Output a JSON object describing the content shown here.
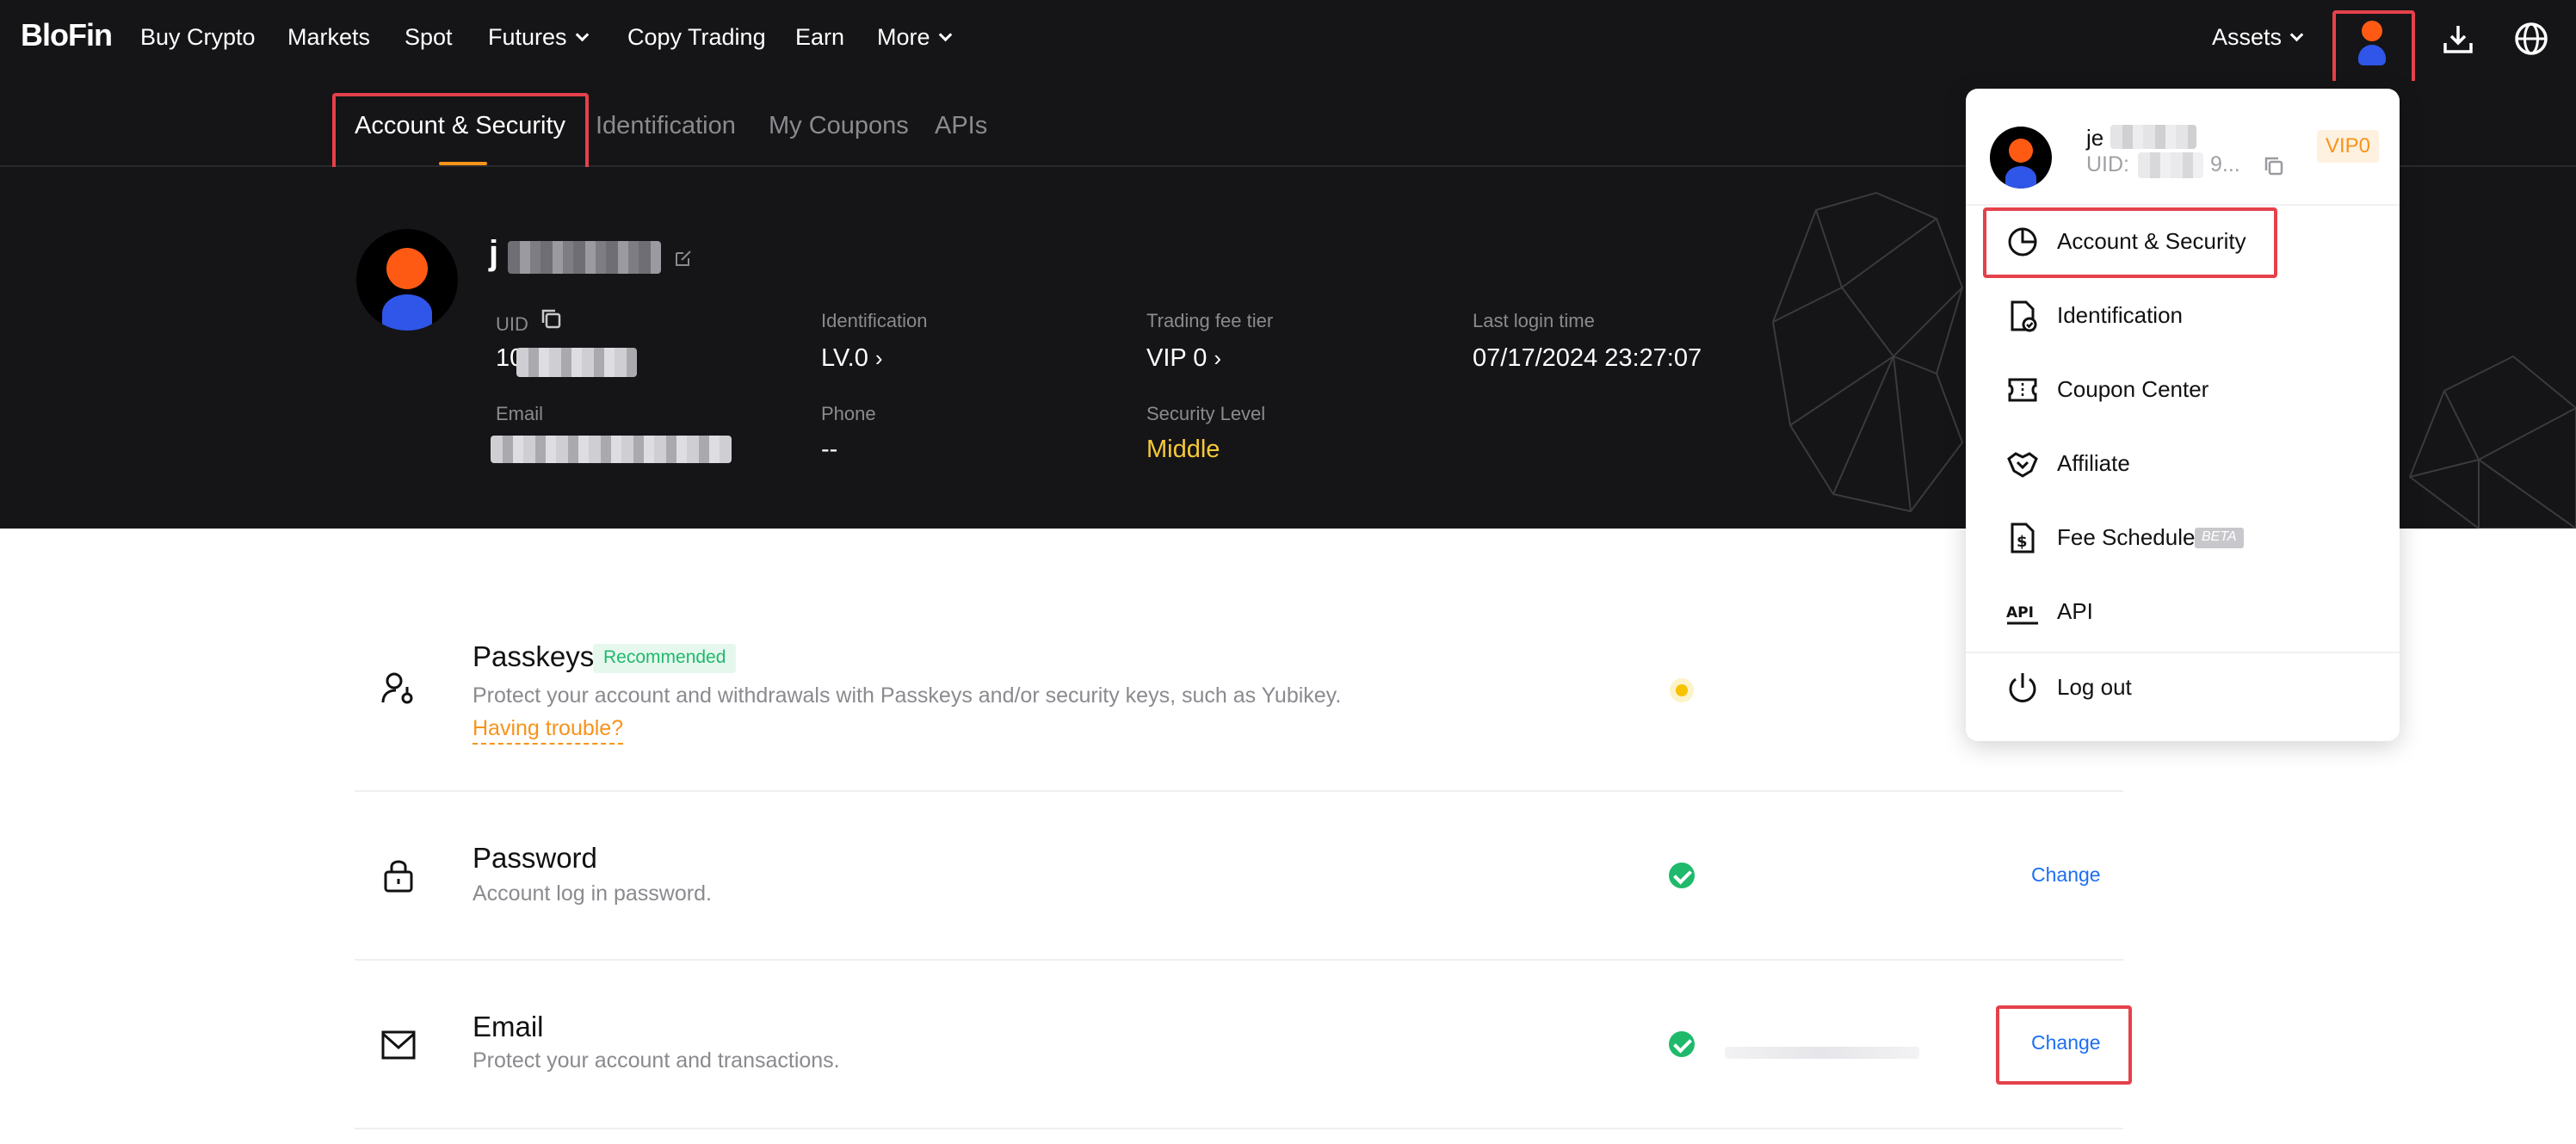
{
  "nav": {
    "logo": "BloFin",
    "items": [
      {
        "label": "Buy Crypto"
      },
      {
        "label": "Markets"
      },
      {
        "label": "Spot"
      },
      {
        "label": "Futures"
      },
      {
        "label": "Copy Trading"
      },
      {
        "label": "Earn"
      },
      {
        "label": "More"
      }
    ],
    "assets_label": "Assets",
    "icons": [
      "user-avatar-icon",
      "download-icon",
      "globe-icon"
    ]
  },
  "tabs": [
    {
      "label": "Account & Security",
      "active": true
    },
    {
      "label": "Identification"
    },
    {
      "label": "My Coupons"
    },
    {
      "label": "APIs"
    }
  ],
  "profile": {
    "name_visible": "j",
    "uid_label": "UID",
    "uid_value": "10",
    "email_label": "Email",
    "identification_label": "Identification",
    "identification_value": "LV.0",
    "phone_label": "Phone",
    "phone_value": "--",
    "fee_tier_label": "Trading fee tier",
    "fee_tier_value": "VIP 0",
    "security_level_label": "Security Level",
    "security_level_value": "Middle",
    "last_login_label": "Last login time",
    "last_login_value": "07/17/2024 23:27:07"
  },
  "security": {
    "passkeys": {
      "title": "Passkeys",
      "badge": "Recommended",
      "desc": "Protect your account and withdrawals with Passkeys and/or security keys, such as Yubikey.",
      "link": "Having trouble?"
    },
    "password": {
      "title": "Password",
      "desc": "Account log in password.",
      "action": "Change"
    },
    "email": {
      "title": "Email",
      "desc": "Protect your account and transactions.",
      "action": "Change"
    }
  },
  "dropdown": {
    "user_name_visible": "je",
    "uid_label": "UID:",
    "uid_suffix": "9...",
    "vip_badge": "VIP0",
    "items": [
      {
        "label": "Account & Security",
        "icon": "pie-chart-icon"
      },
      {
        "label": "Identification",
        "icon": "id-document-icon"
      },
      {
        "label": "Coupon Center",
        "icon": "coupon-icon"
      },
      {
        "label": "Affiliate",
        "icon": "handshake-icon"
      },
      {
        "label": "Fee Schedule",
        "icon": "fee-document-icon",
        "badge": "BETA"
      },
      {
        "label": "API",
        "icon": "api-icon"
      },
      {
        "label": "Log out",
        "icon": "power-icon"
      }
    ]
  },
  "colors": {
    "dark_bg": "#151517",
    "accent_orange": "#f7931a",
    "security_middle": "#f7c93b",
    "check_green": "#1fb96b",
    "link_blue": "#1d6ff2",
    "highlight_red": "#e5414b"
  }
}
